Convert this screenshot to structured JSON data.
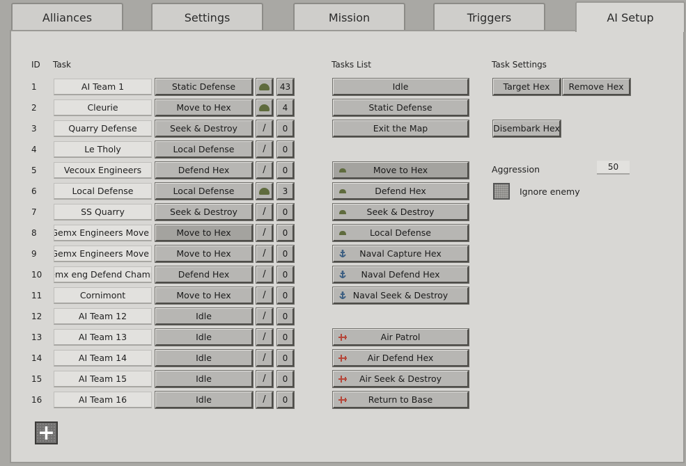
{
  "tabs": [
    "Alliances",
    "Settings",
    "Mission",
    "Triggers",
    "AI Setup"
  ],
  "headers": {
    "id": "ID",
    "task": "Task",
    "tasks_list": "Tasks List",
    "task_settings": "Task Settings"
  },
  "teams": [
    {
      "id": "1",
      "name": "AI Team 1",
      "task": "Static Defense",
      "unit": "helmet",
      "count": "43"
    },
    {
      "id": "2",
      "name": "Cleurie",
      "task": "Move to Hex",
      "unit": "helmet",
      "count": "4"
    },
    {
      "id": "3",
      "name": "Quarry Defense",
      "task": "Seek & Destroy",
      "unit": "/",
      "count": "0"
    },
    {
      "id": "4",
      "name": "Le Tholy",
      "task": "Local Defense",
      "unit": "/",
      "count": "0"
    },
    {
      "id": "5",
      "name": "Vecoux Engineers",
      "task": "Defend Hex",
      "unit": "/",
      "count": "0"
    },
    {
      "id": "6",
      "name": "Local Defense",
      "task": "Local Defense",
      "unit": "helmet",
      "count": "3"
    },
    {
      "id": "7",
      "name": "SS Quarry",
      "task": "Seek & Destroy",
      "unit": "/",
      "count": "0"
    },
    {
      "id": "8",
      "name": "Gemx Engineers Move I",
      "task": "Move to Hex",
      "unit": "/",
      "count": "0",
      "selected": true
    },
    {
      "id": "9",
      "name": "Gemx Engineers Move I",
      "task": "Move to Hex",
      "unit": "/",
      "count": "0"
    },
    {
      "id": "10",
      "name": "emx eng Defend Champ",
      "task": "Defend Hex",
      "unit": "/",
      "count": "0"
    },
    {
      "id": "11",
      "name": "Cornimont",
      "task": "Move to Hex",
      "unit": "/",
      "count": "0"
    },
    {
      "id": "12",
      "name": "AI Team 12",
      "task": "Idle",
      "unit": "/",
      "count": "0"
    },
    {
      "id": "13",
      "name": "AI Team 13",
      "task": "Idle",
      "unit": "/",
      "count": "0"
    },
    {
      "id": "14",
      "name": "AI Team 14",
      "task": "Idle",
      "unit": "/",
      "count": "0"
    },
    {
      "id": "15",
      "name": "AI Team 15",
      "task": "Idle",
      "unit": "/",
      "count": "0"
    },
    {
      "id": "16",
      "name": "AI Team 16",
      "task": "Idle",
      "unit": "/",
      "count": "0"
    }
  ],
  "tasks_list": [
    {
      "label": "Idle",
      "icon": ""
    },
    {
      "label": "Static Defense",
      "icon": ""
    },
    {
      "label": "Exit the Map",
      "icon": ""
    },
    {
      "label": "Move to Hex",
      "icon": "helmet-icon",
      "selected": true
    },
    {
      "label": "Defend Hex",
      "icon": "helmet-icon"
    },
    {
      "label": "Seek & Destroy",
      "icon": "helmet-icon"
    },
    {
      "label": "Local Defense",
      "icon": "helmet-icon"
    },
    {
      "label": "Naval Capture Hex",
      "icon": "anchor-icon"
    },
    {
      "label": "Naval Defend Hex",
      "icon": "anchor-icon"
    },
    {
      "label": "Naval Seek & Destroy",
      "icon": "anchor-icon"
    },
    {
      "label": "Air Patrol",
      "icon": "plane-icon"
    },
    {
      "label": "Air Defend Hex",
      "icon": "plane-icon"
    },
    {
      "label": "Air Seek & Destroy",
      "icon": "plane-icon"
    },
    {
      "label": "Return to Base",
      "icon": "plane-icon"
    }
  ],
  "task_settings": {
    "target_hex": "Target Hex",
    "remove_hex": "Remove Hex",
    "disembark_hex": "Disembark Hex",
    "aggression_label": "Aggression",
    "aggression_value": "50",
    "ignore_enemy_label": "Ignore enemy"
  },
  "add_button": "+",
  "colors": {
    "helmet": "#5f6b3d",
    "anchor": "#3d5f82",
    "plane": "#b5473a",
    "panel": "#d8d7d4"
  }
}
